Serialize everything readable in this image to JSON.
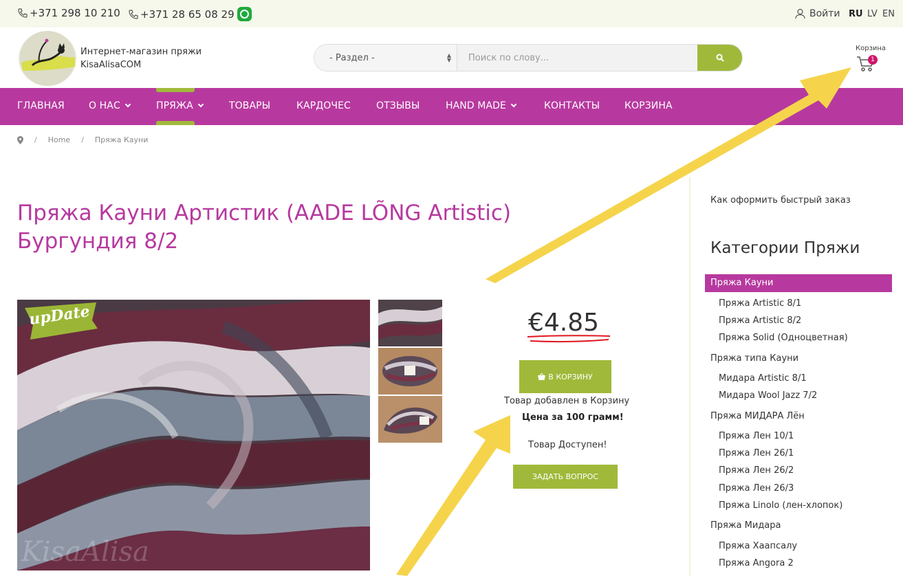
{
  "topbar": {
    "phone1": "+371 298 10 210",
    "phone2": "+371 28 65 08 29",
    "phone_icon": "phone-icon",
    "whatsapp_icon": "whatsapp-icon",
    "login": "Войти",
    "login_icon": "user-icon",
    "langs": [
      "RU",
      "LV",
      "EN"
    ],
    "active_lang": "RU"
  },
  "header": {
    "shop_line1": "Интернет-магазин пряжи",
    "shop_line2": "KisaAlisaCOM",
    "section_select": "- Раздел -",
    "search_placeholder": "Поиск по слову...",
    "search_icon": "search-icon",
    "cart_label": "Корзина",
    "cart_count": "1",
    "cart_icon": "cart-icon"
  },
  "nav": {
    "items": [
      "ГЛАВНАЯ",
      "О НАС",
      "ПРЯЖА",
      "ТОВАРЫ",
      "КАРДОЧЕС",
      "ОТЗЫВЫ",
      "HAND MADE",
      "КОНТАКТЫ",
      "КОРЗИНА"
    ],
    "active": "ПРЯЖА",
    "accent": "#b7399f",
    "highlight": "#a0b93a"
  },
  "breadcrumb": {
    "icon": "map-pin-icon",
    "home": "Home",
    "current": "Пряжа Кауни"
  },
  "product": {
    "title": "Пряжа Кауни Артистик (AADE LÕNG Artistic) Бургундия 8/2",
    "badge": "upDate",
    "watermark": "KisaAlisa",
    "price": "€4.85",
    "add_to_cart": "В КОРЗИНУ",
    "added_msg": "Товар добавлен в Корзину",
    "per_100g": "Цена за 100 грамм!",
    "available": "Товар Доступен!",
    "ask": "ЗАДАТЬ ВОПРОС"
  },
  "sidebar": {
    "quick_order": "Как оформить быстрый заказ",
    "categories_title": "Категории Пряжи",
    "active_category": "Пряжа Кауни",
    "items": [
      {
        "label": "Пряжа Artistic 8/1",
        "level": 2
      },
      {
        "label": "Пряжа Artistic 8/2",
        "level": 2
      },
      {
        "label": "Пряжа Solid (Одноцветная)",
        "level": 2
      },
      {
        "label": "Пряжа типа Кауни",
        "level": 1
      },
      {
        "label": "Мидара Artistic 8/1",
        "level": 2
      },
      {
        "label": "Мидара Wool Jazz 7/2",
        "level": 2
      },
      {
        "label": "Пряжа МИДАРА Лён",
        "level": 1
      },
      {
        "label": "Пряжа Лен 10/1",
        "level": 2
      },
      {
        "label": "Пряжа Лен 26/1",
        "level": 2
      },
      {
        "label": "Пряжа Лен 26/2",
        "level": 2
      },
      {
        "label": "Пряжа Лен 26/3",
        "level": 2
      },
      {
        "label": "Пряжа Linolo (лен-хлопок)",
        "level": 2
      },
      {
        "label": "Пряжа Мидара",
        "level": 1
      },
      {
        "label": "Пряжа Хаапсалу",
        "level": 2
      },
      {
        "label": "Пряжа Angora 2",
        "level": 2
      }
    ]
  }
}
